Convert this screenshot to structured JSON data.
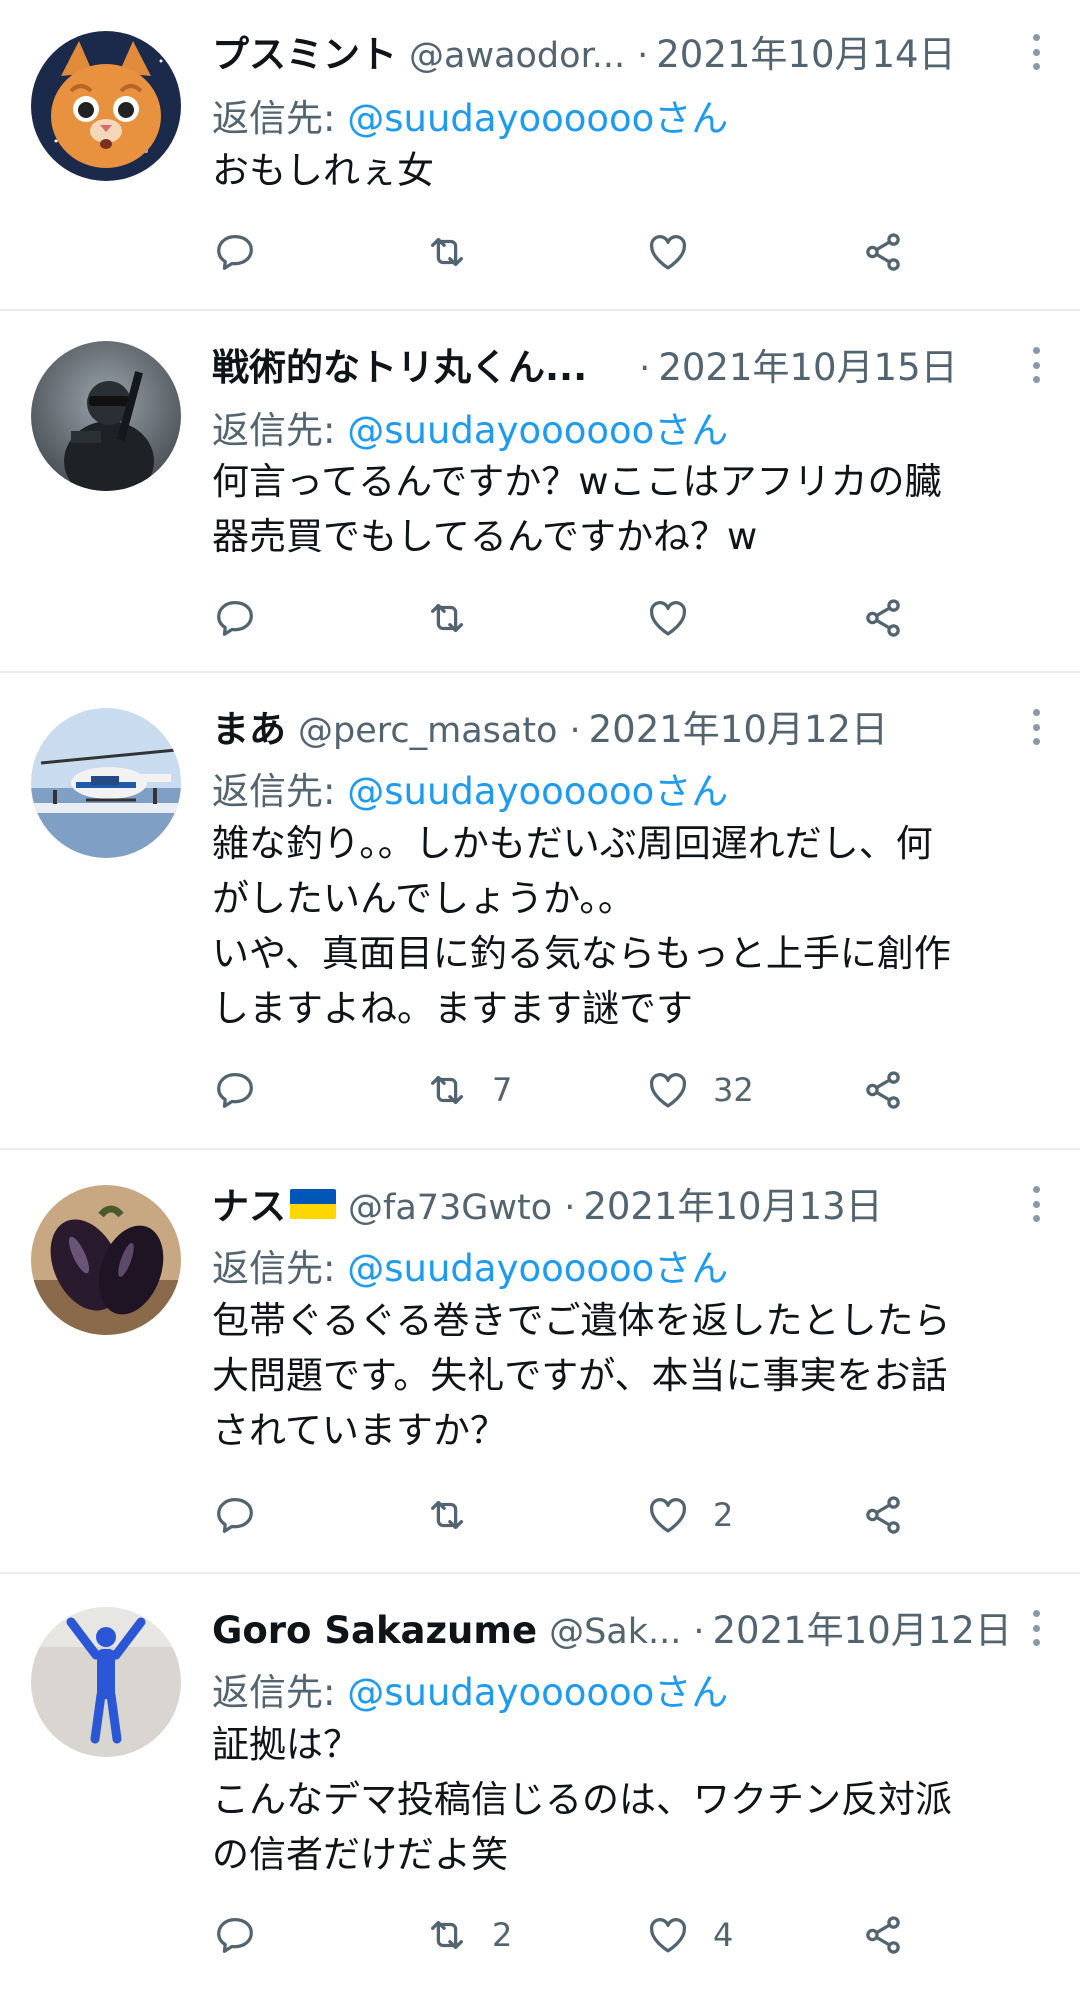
{
  "tweets": [
    {
      "name": "プスミント",
      "handle": "@awaodor...",
      "sep": "·",
      "date": "2021年10月14日",
      "reply_prefix": "返信先: ",
      "reply_to": "@suudayoooooo",
      "reply_suffix": "さん",
      "lines": [
        "おもしれぇ女"
      ],
      "retweets": "",
      "likes": ""
    },
    {
      "name": "戦術的なトリ丸くん...",
      "handle": "",
      "sep": "·",
      "date": "2021年10月15日",
      "reply_prefix": "返信先: ",
      "reply_to": "@suudayoooooo",
      "reply_suffix": "さん",
      "lines": [
        "何言ってるんですか？wここはアフリカの臓",
        "器売買でもしてるんですかね？w"
      ],
      "retweets": "",
      "likes": ""
    },
    {
      "name": "まあ",
      "handle": "@perc_masato",
      "sep": "·",
      "date": "2021年10月12日",
      "reply_prefix": "返信先: ",
      "reply_to": "@suudayoooooo",
      "reply_suffix": "さん",
      "lines": [
        "雑な釣り。。しかもだいぶ周回遅れだし、何",
        "がしたいんでしょうか。。",
        "いや、真面目に釣る気ならもっと上手に創作",
        "しますよね。ますます謎です"
      ],
      "retweets": "7",
      "likes": "32"
    },
    {
      "name": "ナス",
      "handle": "@fa73Gwto",
      "sep": "·",
      "date": "2021年10月13日",
      "reply_prefix": "返信先: ",
      "reply_to": "@suudayoooooo",
      "reply_suffix": "さん",
      "lines": [
        "包帯ぐるぐる巻きでご遺体を返したとしたら",
        "大問題です。失礼ですが、本当に事実をお話",
        "されていますか？"
      ],
      "retweets": "",
      "likes": "2"
    },
    {
      "name": "Goro Sakazume",
      "handle": "@Sak...",
      "sep": "·",
      "date": "2021年10月12日",
      "reply_prefix": "返信先: ",
      "reply_to": "@suudayoooooo",
      "reply_suffix": "さん",
      "lines": [
        "証拠は？",
        "こんなデマ投稿信じるのは、ワクチン反対派",
        "の信者だけだよ笑"
      ],
      "retweets": "2",
      "likes": "4"
    }
  ],
  "icons": {
    "reply": "reply-icon",
    "retweet": "retweet-icon",
    "like": "like-icon",
    "share": "share-icon",
    "more": "more-icon"
  },
  "colors": {
    "link": "#1d9bf0",
    "secondary": "#536471",
    "divider": "#e6ecf0",
    "flag_blue": "#0057b7",
    "flag_yellow": "#ffd700"
  }
}
